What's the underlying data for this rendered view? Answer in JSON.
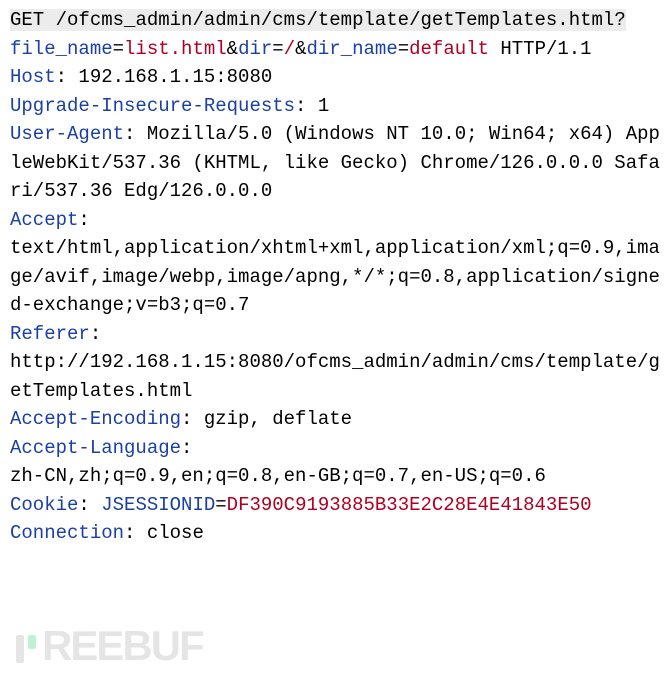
{
  "request": {
    "method": "GET",
    "path": "/ofcms_admin/admin/cms/template/getTemplates.html?",
    "params": [
      {
        "key": "file_name",
        "sep": "=",
        "value": "list.html"
      },
      {
        "key": "dir",
        "sep": "=",
        "value": "/",
        "pre": "&"
      },
      {
        "key": "dir_name",
        "sep": "=",
        "value": "default",
        "pre": "&"
      }
    ],
    "http_version": "HTTP/1.1"
  },
  "headers": [
    {
      "name": "Host",
      "value": "192.168.1.15:8080"
    },
    {
      "name": "Upgrade-Insecure-Requests",
      "value": "1"
    },
    {
      "name": "User-Agent",
      "value": "Mozilla/5.0 (Windows NT 10.0; Win64; x64) AppleWebKit/537.36 (KHTML, like Gecko) Chrome/126.0.0.0 Safari/537.36 Edg/126.0.0.0"
    },
    {
      "name": "Accept",
      "value": "text/html,application/xhtml+xml,application/xml;q=0.9,image/avif,image/webp,image/apng,*/*;q=0.8,application/signed-exchange;v=b3;q=0.7"
    },
    {
      "name": "Referer",
      "value": "http://192.168.1.15:8080/ofcms_admin/admin/cms/template/getTemplates.html"
    },
    {
      "name": "Accept-Encoding",
      "value": "gzip, deflate"
    },
    {
      "name": "Accept-Language",
      "value": "zh-CN,zh;q=0.9,en;q=0.8,en-GB;q=0.7,en-US;q=0.6"
    }
  ],
  "cookie": {
    "name": "Cookie",
    "key": "JSESSIONID",
    "sep": "=",
    "value": "DF390C9193885B33E2C28E4E41843E50"
  },
  "connection": {
    "name": "Connection",
    "value": "close"
  },
  "watermark": "REEBUF"
}
